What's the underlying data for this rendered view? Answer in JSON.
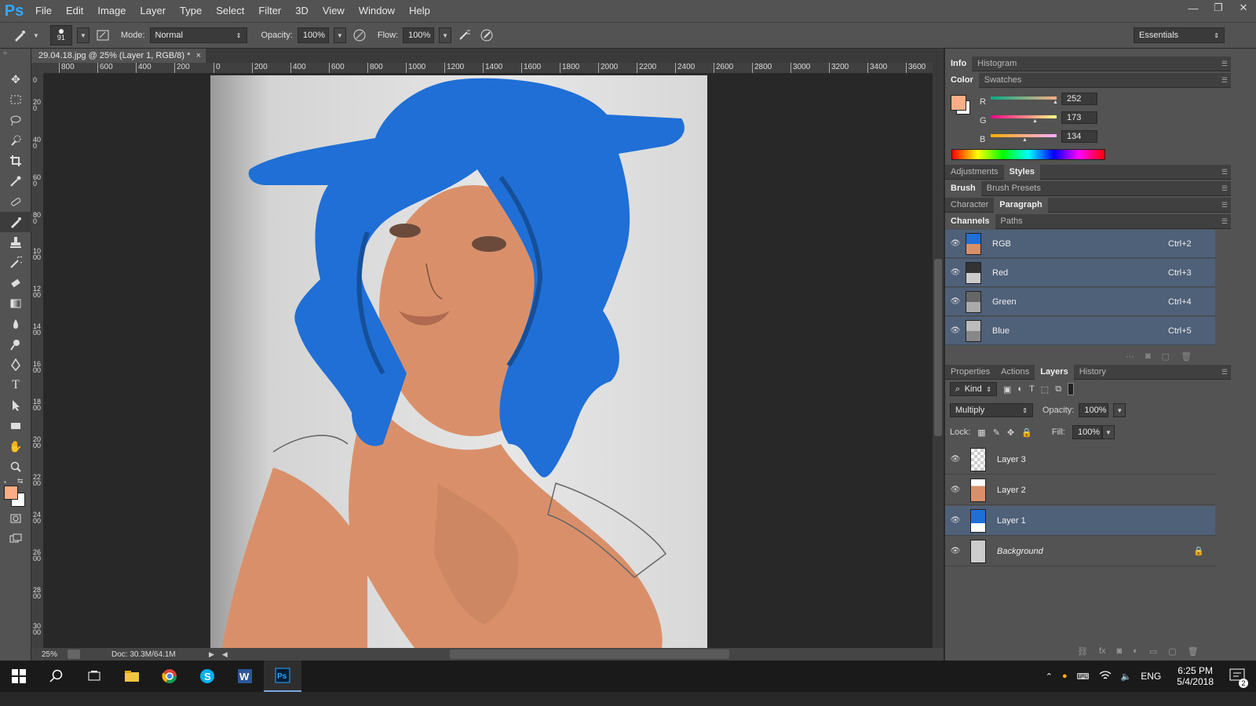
{
  "menubar": {
    "logo": "Ps",
    "items": [
      "File",
      "Edit",
      "Image",
      "Layer",
      "Type",
      "Select",
      "Filter",
      "3D",
      "View",
      "Window",
      "Help"
    ],
    "win_min": "—",
    "win_max": "❐",
    "win_close": "✕"
  },
  "options": {
    "brush_size": "91",
    "mode_label": "Mode:",
    "mode_value": "Normal",
    "opacity_label": "Opacity:",
    "opacity_value": "100%",
    "flow_label": "Flow:",
    "flow_value": "100%",
    "workspace": "Essentials"
  },
  "document": {
    "tab_title": "29.04.18.jpg @ 25% (Layer 1, RGB/8) *",
    "tab_close": "×",
    "zoom": "25%",
    "doc_info": "Doc: 30.3M/64.1M"
  },
  "ruler": {
    "h_labels": [
      "800",
      "600",
      "400",
      "200",
      "0",
      "200",
      "400",
      "600",
      "800",
      "1000",
      "1200",
      "1400",
      "1600",
      "1800",
      "2000",
      "2200",
      "2400",
      "2600",
      "2800",
      "3000",
      "3200",
      "3400",
      "3600"
    ],
    "v_labels": [
      "0",
      "200",
      "400",
      "600",
      "800",
      "1000",
      "1200",
      "1400",
      "1600",
      "1800",
      "2000",
      "2200",
      "2400",
      "2600",
      "2800",
      "3000"
    ]
  },
  "panels": {
    "info_tabs": [
      "Info",
      "Histogram"
    ],
    "color_tabs": [
      "Color",
      "Swatches"
    ],
    "color": {
      "fg": "#fcad86",
      "r_label": "R",
      "r": "252",
      "g_label": "G",
      "g": "173",
      "b_label": "B",
      "b": "134"
    },
    "adjust_tabs": [
      "Adjustments",
      "Styles"
    ],
    "brush_tabs": [
      "Brush",
      "Brush Presets"
    ],
    "char_tabs": [
      "Character",
      "Paragraph"
    ],
    "channel_tabs": [
      "Channels",
      "Paths"
    ],
    "channels": [
      {
        "name": "RGB",
        "shortcut": "Ctrl+2"
      },
      {
        "name": "Red",
        "shortcut": "Ctrl+3"
      },
      {
        "name": "Green",
        "shortcut": "Ctrl+4"
      },
      {
        "name": "Blue",
        "shortcut": "Ctrl+5"
      }
    ],
    "layer_tabs": [
      "Properties",
      "Actions",
      "Layers",
      "History"
    ],
    "layers_filter": "Kind",
    "blend_mode": "Multiply",
    "opacity_label": "Opacity:",
    "opacity": "100%",
    "lock_label": "Lock:",
    "fill_label": "Fill:",
    "fill": "100%",
    "layers": [
      {
        "name": "Layer 3"
      },
      {
        "name": "Layer 2"
      },
      {
        "name": "Layer 1"
      },
      {
        "name": "Background"
      }
    ]
  },
  "taskbar": {
    "lang": "ENG",
    "time": "6:25 PM",
    "date": "5/4/2018",
    "notif_count": "2"
  },
  "colors": {
    "skin": "#d9906a",
    "hair": "#1f6fd6",
    "paper": "#e0e0e0",
    "selection": "#4f6079"
  }
}
